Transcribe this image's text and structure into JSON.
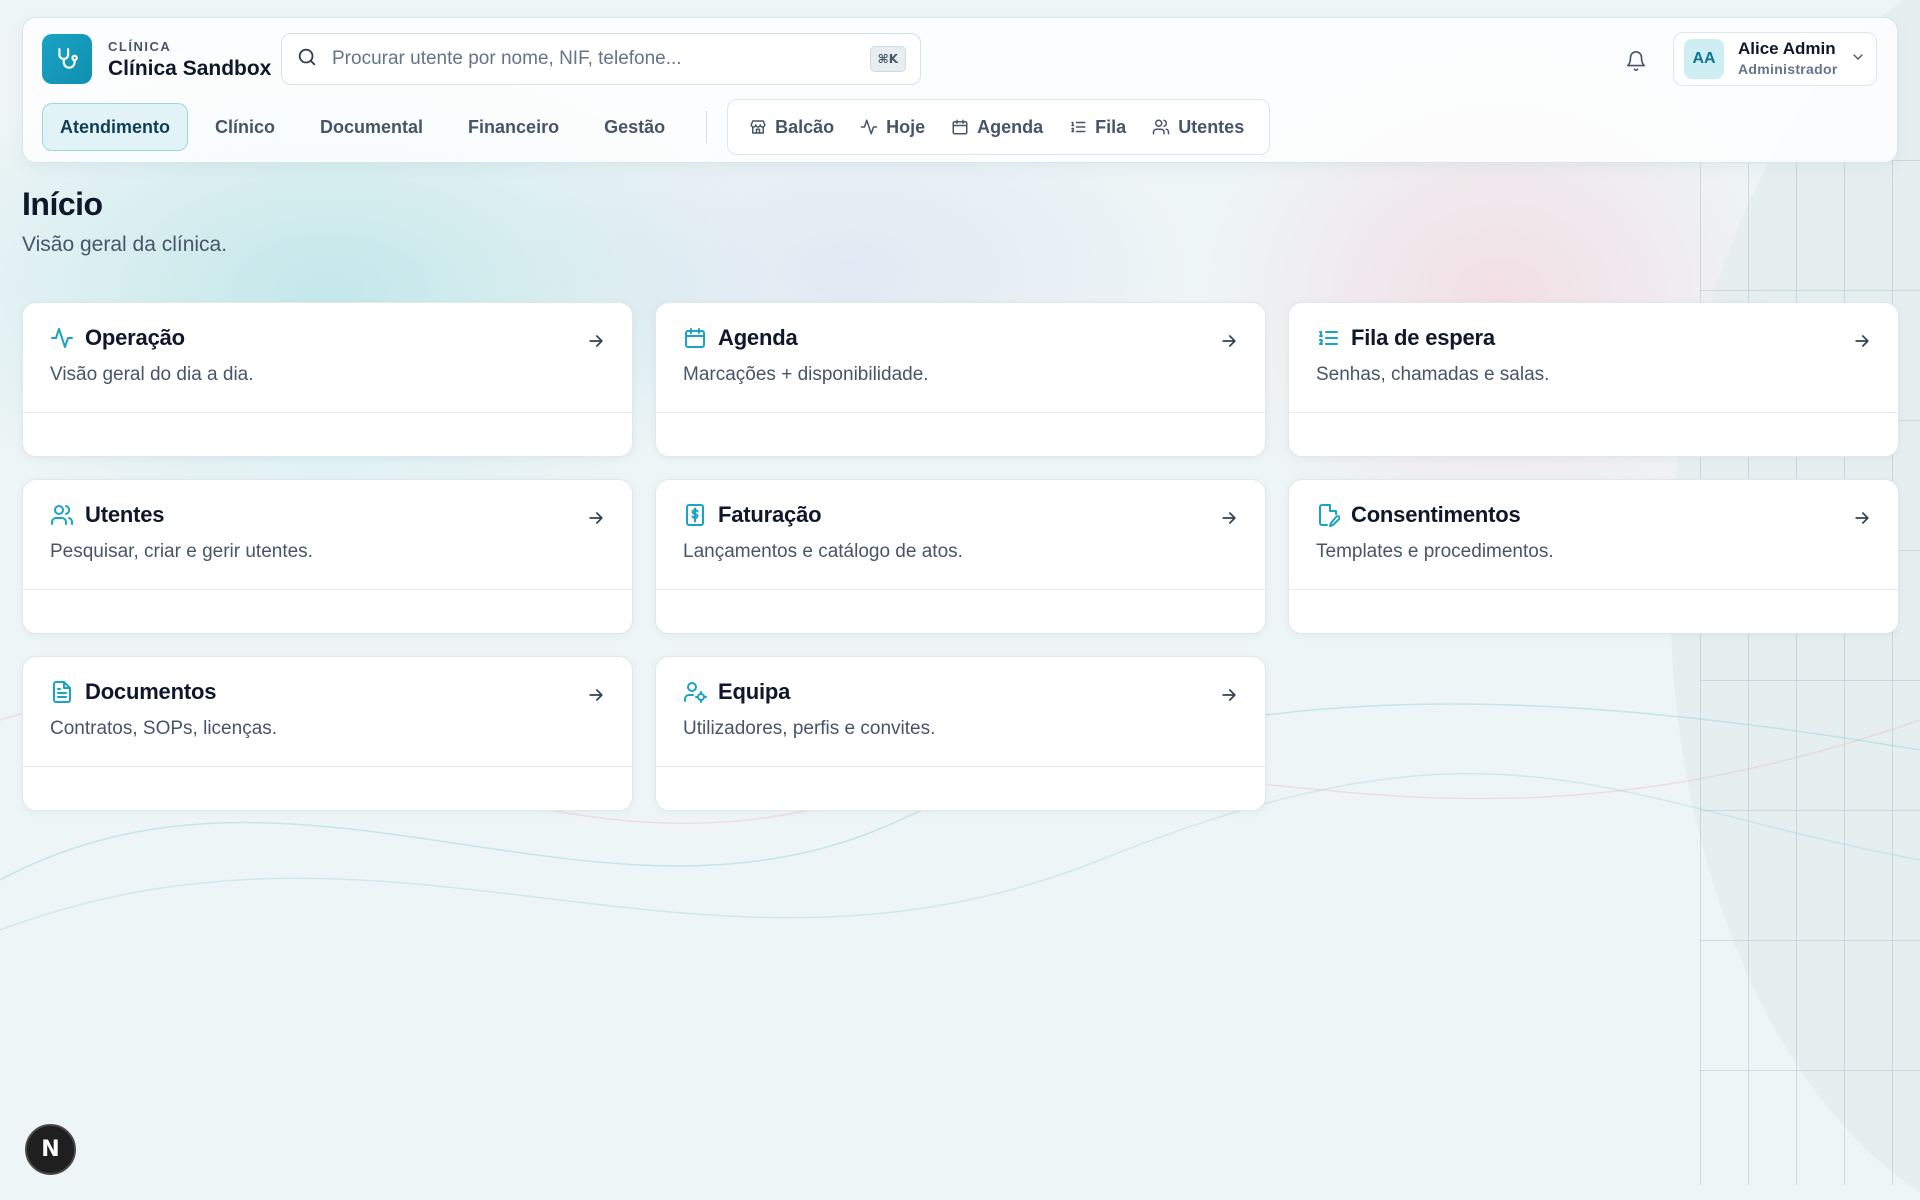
{
  "brand": {
    "kicker": "CLÍNICA",
    "name": "Clínica Sandbox",
    "logo_icon": "stethoscope-icon",
    "accent": "#1aa3c4"
  },
  "search": {
    "placeholder": "Procurar utente por nome, NIF, telefone...",
    "value": "",
    "shortcut": "⌘K"
  },
  "user": {
    "initials": "AA",
    "name": "Alice Admin",
    "role": "Administrador"
  },
  "nav": {
    "tabs": [
      {
        "label": "Atendimento",
        "active": true
      },
      {
        "label": "Clínico",
        "active": false
      },
      {
        "label": "Documental",
        "active": false
      },
      {
        "label": "Financeiro",
        "active": false
      },
      {
        "label": "Gestão",
        "active": false
      }
    ],
    "quick_links": [
      {
        "label": "Balcão",
        "icon": "store-icon"
      },
      {
        "label": "Hoje",
        "icon": "activity-icon"
      },
      {
        "label": "Agenda",
        "icon": "calendar-icon"
      },
      {
        "label": "Fila",
        "icon": "list-ordered-icon"
      },
      {
        "label": "Utentes",
        "icon": "users-icon"
      }
    ]
  },
  "page": {
    "title": "Início",
    "subtitle": "Visão geral da clínica."
  },
  "cards": [
    {
      "title": "Operação",
      "desc": "Visão geral do dia a dia.",
      "icon": "activity-icon"
    },
    {
      "title": "Agenda",
      "desc": "Marcações + disponibilidade.",
      "icon": "calendar-icon"
    },
    {
      "title": "Fila de espera",
      "desc": "Senhas, chamadas e salas.",
      "icon": "list-ordered-icon"
    },
    {
      "title": "Utentes",
      "desc": "Pesquisar, criar e gerir utentes.",
      "icon": "users-icon"
    },
    {
      "title": "Faturação",
      "desc": "Lançamentos e catálogo de atos.",
      "icon": "receipt-icon"
    },
    {
      "title": "Consentimentos",
      "desc": "Templates e procedimentos.",
      "icon": "file-signature-icon"
    },
    {
      "title": "Documentos",
      "desc": "Contratos, SOPs, licenças.",
      "icon": "file-text-icon"
    },
    {
      "title": "Equipa",
      "desc": "Utilizadores, perfis e convites.",
      "icon": "user-cog-icon"
    }
  ],
  "dev_badge": "N"
}
